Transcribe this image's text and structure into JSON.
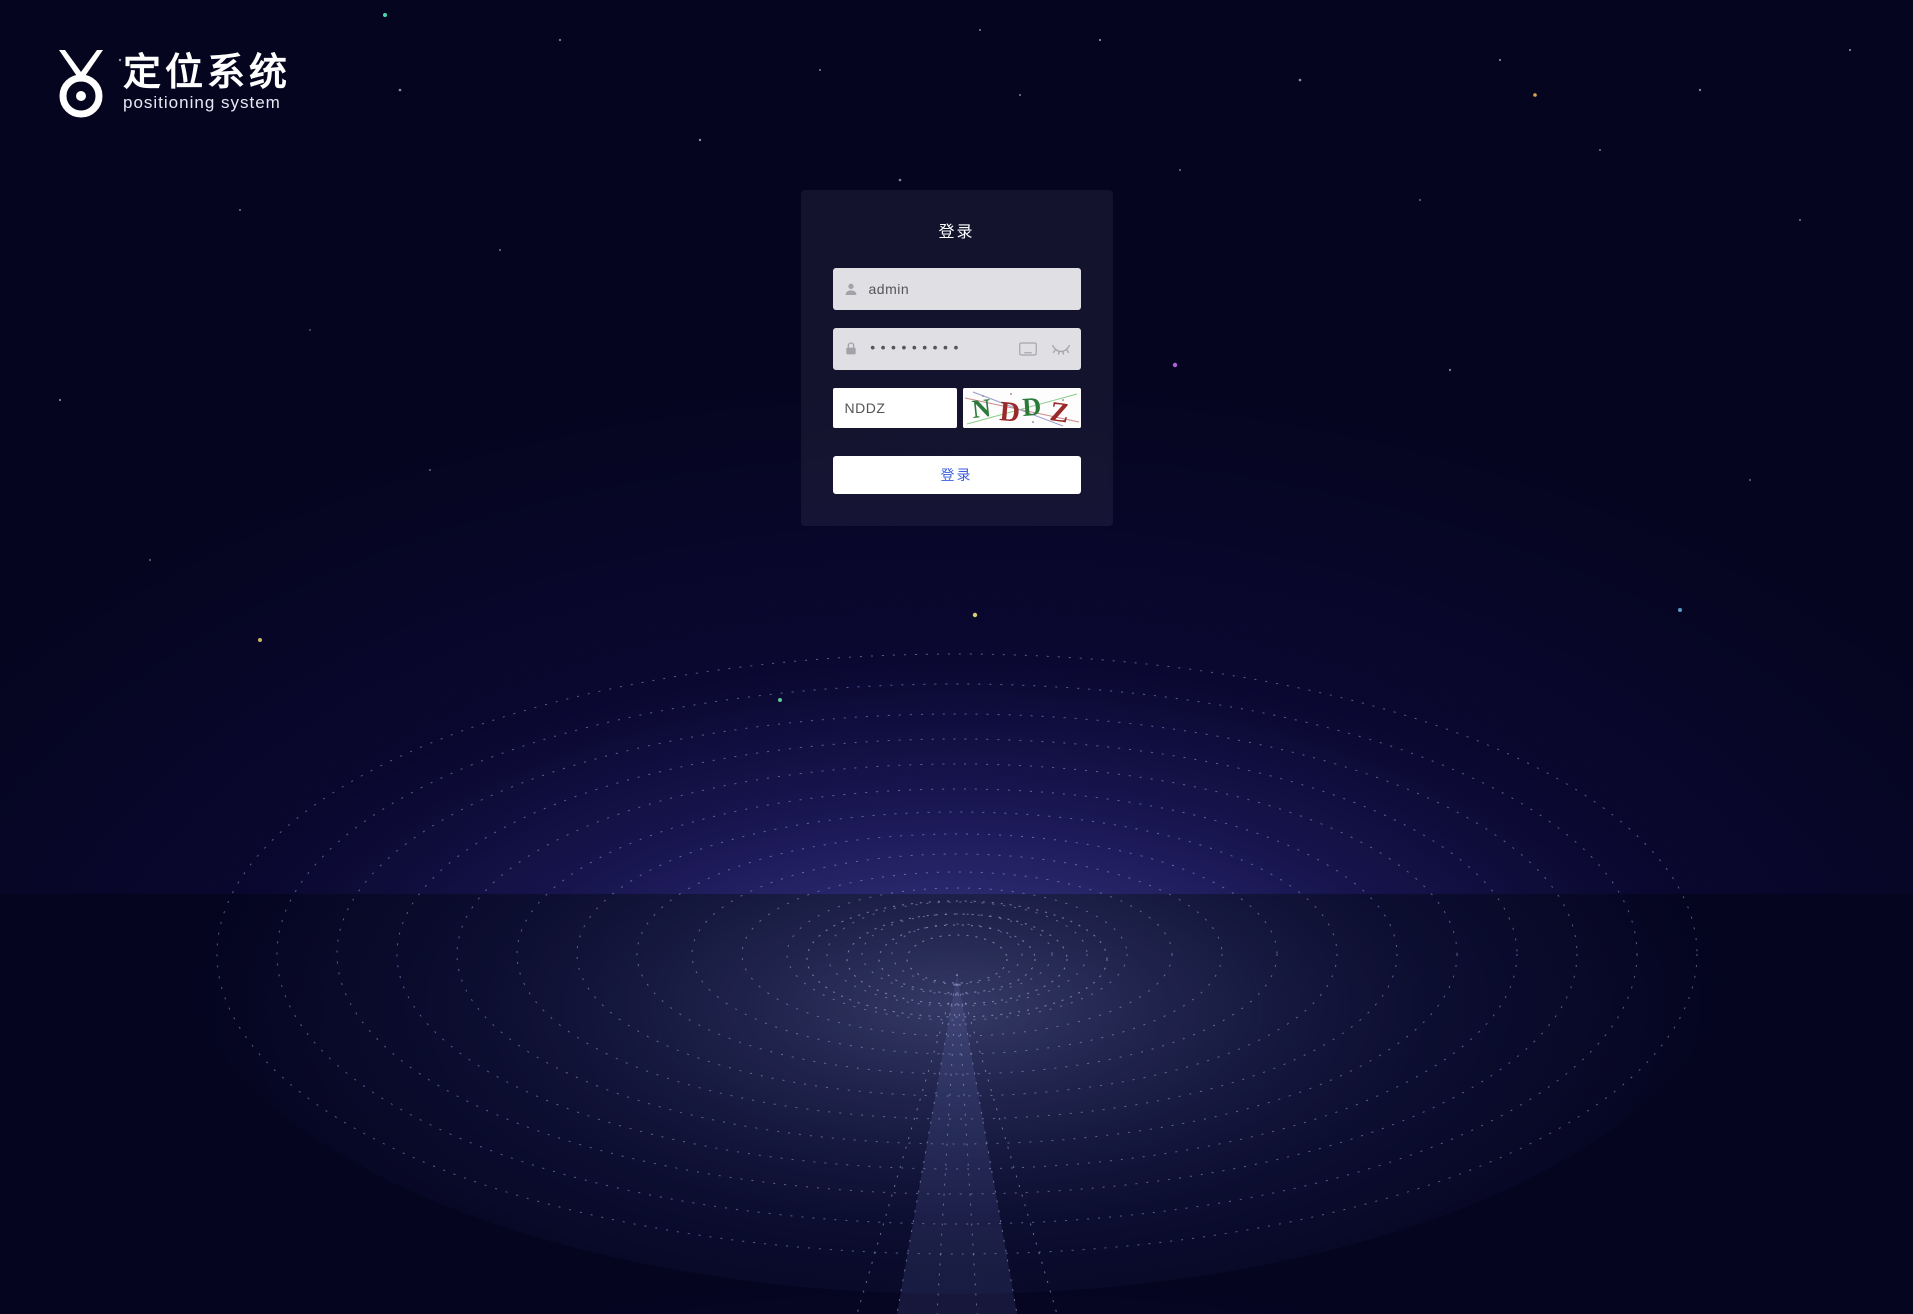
{
  "brand": {
    "title": "定位系统",
    "subtitle": "positioning system"
  },
  "login": {
    "heading": "登录",
    "username_value": "admin",
    "password_value": "•••••••••",
    "captcha_value": "NDDZ",
    "captcha_image_text": "NDDZ",
    "submit_label": "登录"
  },
  "icons": {
    "user": "user-icon",
    "lock": "lock-icon",
    "keyboard": "keyboard-icon",
    "eye_closed": "eye-closed-icon"
  },
  "colors": {
    "accent": "#3b5fe0",
    "field_bg": "#e0e0e4",
    "card_bg": "rgba(255,255,255,0.06)"
  }
}
